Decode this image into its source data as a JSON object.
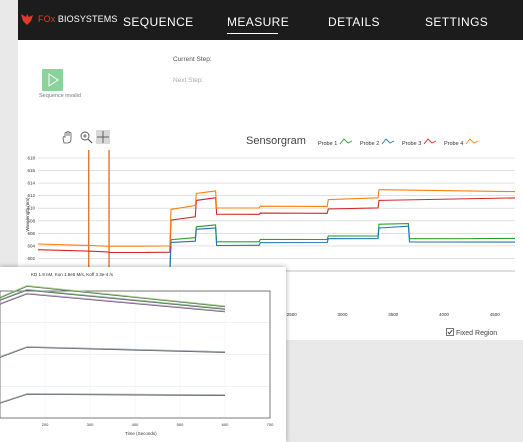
{
  "nav": {
    "brand_prefix": "FOx",
    "brand_suffix": " BIOSYSTEMS",
    "items": [
      {
        "label": "SEQUENCE",
        "active": false
      },
      {
        "label": "MEASURE",
        "active": true
      },
      {
        "label": "DETAILS",
        "active": false
      },
      {
        "label": "SETTINGS",
        "active": false
      }
    ]
  },
  "sequence": {
    "invalid_label": "Sequence invalid",
    "current_step_label": "Current Step:",
    "next_step_label": "Next Step:"
  },
  "toolbar": {
    "icons": [
      "pan-hand-icon",
      "zoom-icon",
      "crosshair-icon"
    ]
  },
  "colors": {
    "probe1": "#2ca02c",
    "probe2": "#1f77b4",
    "probe3": "#d62728",
    "probe4": "#ff7f0e",
    "nav_bg": "#1c1c1c"
  },
  "fixed_region": {
    "label": "Fixed Region",
    "checked": true
  },
  "chart_data": [
    {
      "type": "line",
      "title": "Sensorgram",
      "ylabel": "Wavelength (nm)",
      "xlabel": "",
      "y_ticks": [
        "618",
        "616",
        "614",
        "612",
        "610",
        "608",
        "606",
        "604",
        "602",
        "600"
      ],
      "x_ticks": [
        "2500",
        "3000",
        "3500",
        "4000",
        "4500"
      ],
      "ylim": [
        600,
        618
      ],
      "xlim": [
        0,
        4700
      ],
      "grid": true,
      "legend": "top-right",
      "vertical_markers": [
        500,
        700
      ],
      "series": [
        {
          "name": "Probe 1",
          "color_key": "probe1",
          "x": [
            0,
            480,
            520,
            680,
            720,
            1050,
            1300,
            1310,
            1550,
            1560,
            1750,
            1760,
            2180,
            2190,
            2850,
            2860,
            3350,
            3360,
            3650,
            3660,
            4300,
            4310,
            4700
          ],
          "y": [
            600.2,
            600.2,
            600.2,
            600.2,
            600.2,
            600.2,
            600.2,
            605.0,
            605.3,
            607.0,
            607.3,
            604.6,
            604.6,
            605.0,
            605.0,
            605.6,
            605.6,
            607.5,
            607.6,
            605.2,
            605.2,
            605.2,
            605.2
          ]
        },
        {
          "name": "Probe 2",
          "color_key": "probe2",
          "x": [
            0,
            1300,
            1310,
            1550,
            1560,
            1750,
            1760,
            2180,
            2190,
            2850,
            2860,
            3350,
            3360,
            3650,
            3660,
            4700
          ],
          "y": [
            600.0,
            600.0,
            604.6,
            604.8,
            606.7,
            606.9,
            604.1,
            604.1,
            604.5,
            604.5,
            605.1,
            605.1,
            606.8,
            607.1,
            604.6,
            604.6
          ]
        },
        {
          "name": "Probe 3",
          "color_key": "probe3",
          "x": [
            0,
            480,
            520,
            680,
            720,
            1050,
            1060,
            1300,
            1310,
            1550,
            1560,
            1750,
            1760,
            2180,
            2190,
            2850,
            2860,
            3350,
            3360,
            4700
          ],
          "y": [
            603.4,
            603.2,
            603.2,
            603.1,
            603.0,
            603.0,
            603.0,
            603.0,
            608.1,
            608.6,
            611.2,
            611.6,
            609.0,
            609.0,
            609.2,
            609.2,
            609.9,
            610.1,
            611.3,
            611.7
          ]
        },
        {
          "name": "Probe 4",
          "color_key": "probe4",
          "x": [
            0,
            480,
            520,
            680,
            720,
            1050,
            1060,
            1300,
            1310,
            1550,
            1560,
            1750,
            1760,
            2180,
            2190,
            2850,
            2860,
            3350,
            3360,
            4700
          ],
          "y": [
            604.3,
            604.1,
            604.1,
            604.0,
            604.0,
            604.0,
            604.0,
            604.0,
            609.8,
            610.4,
            612.3,
            612.7,
            610.0,
            610.0,
            610.3,
            610.3,
            611.4,
            611.7,
            613.0,
            612.7
          ]
        }
      ]
    },
    {
      "type": "line",
      "title": "KD 1.9 nM, Kon 1.8e5 M/s, Koff 3.3e-4 /s",
      "xlabel": "Time (Seconds)",
      "ylabel": "",
      "x_ticks": [
        "200",
        "300",
        "400",
        "500",
        "600",
        "700"
      ],
      "xlim": [
        100,
        700
      ],
      "grid": true,
      "series": [
        {
          "x": [
            100,
            160,
            600
          ],
          "y": [
            0.95,
            1.04,
            0.88
          ],
          "color": "#9ccc7c"
        },
        {
          "x": [
            100,
            160,
            600
          ],
          "y": [
            0.93,
            1.01,
            0.86
          ],
          "color": "#7fba8a"
        },
        {
          "x": [
            100,
            160,
            600
          ],
          "y": [
            0.9,
            0.98,
            0.84
          ],
          "color": "#c6a7d6"
        },
        {
          "x": [
            100,
            160,
            600
          ],
          "y": [
            0.48,
            0.56,
            0.52
          ],
          "color": "#9aa7b4"
        },
        {
          "x": [
            100,
            160,
            600
          ],
          "y": [
            0.12,
            0.19,
            0.18
          ],
          "color": "#9aa7b4"
        }
      ]
    }
  ]
}
